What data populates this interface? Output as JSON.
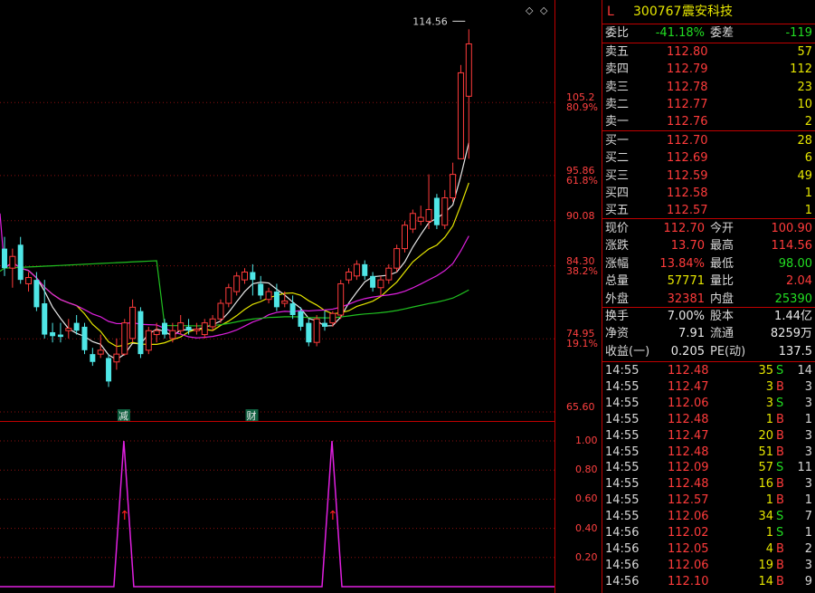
{
  "stock": {
    "flag": "L",
    "code": "300767",
    "name": "震安科技"
  },
  "orderbook": {
    "wb_label": "委比",
    "wb_value": "-41.18%",
    "wc_label": "委差",
    "wc_value": "-119",
    "asks": [
      {
        "label": "卖五",
        "price": "112.80",
        "vol": "57"
      },
      {
        "label": "卖四",
        "price": "112.79",
        "vol": "112"
      },
      {
        "label": "卖三",
        "price": "112.78",
        "vol": "23"
      },
      {
        "label": "卖二",
        "price": "112.77",
        "vol": "10"
      },
      {
        "label": "卖一",
        "price": "112.76",
        "vol": "2"
      }
    ],
    "bids": [
      {
        "label": "买一",
        "price": "112.70",
        "vol": "28"
      },
      {
        "label": "买二",
        "price": "112.69",
        "vol": "6"
      },
      {
        "label": "买三",
        "price": "112.59",
        "vol": "49"
      },
      {
        "label": "买四",
        "price": "112.58",
        "vol": "1"
      },
      {
        "label": "买五",
        "price": "112.57",
        "vol": "1"
      }
    ]
  },
  "stats": [
    {
      "l1": "现价",
      "v1": "112.70",
      "l2": "今开",
      "v2": "100.90",
      "c1": "red",
      "c2": "red"
    },
    {
      "l1": "涨跌",
      "v1": "13.70",
      "l2": "最高",
      "v2": "114.56",
      "c1": "red",
      "c2": "red"
    },
    {
      "l1": "涨幅",
      "v1": "13.84%",
      "l2": "最低",
      "v2": "98.00",
      "c1": "red",
      "c2": "green"
    },
    {
      "l1": "总量",
      "v1": "57771",
      "l2": "量比",
      "v2": "2.04",
      "c1": "yellow",
      "c2": "red"
    },
    {
      "l1": "外盘",
      "v1": "32381",
      "l2": "内盘",
      "v2": "25390",
      "c1": "red",
      "c2": "green"
    }
  ],
  "fundamentals": [
    {
      "l1": "换手",
      "v1": "7.00%",
      "l2": "股本",
      "v2": "1.44亿"
    },
    {
      "l1": "净资",
      "v1": "7.91",
      "l2": "流通",
      "v2": "8259万"
    },
    {
      "l1": "收益(一)",
      "v1": "0.205",
      "l2": "PE(动)",
      "v2": "137.5"
    }
  ],
  "ticks": [
    {
      "time": "14:55",
      "price": "112.48",
      "vol": "35",
      "side": "S",
      "n": "14"
    },
    {
      "time": "14:55",
      "price": "112.47",
      "vol": "3",
      "side": "B",
      "n": "3"
    },
    {
      "time": "14:55",
      "price": "112.06",
      "vol": "3",
      "side": "S",
      "n": "3"
    },
    {
      "time": "14:55",
      "price": "112.48",
      "vol": "1",
      "side": "B",
      "n": "1"
    },
    {
      "time": "14:55",
      "price": "112.47",
      "vol": "20",
      "side": "B",
      "n": "3"
    },
    {
      "time": "14:55",
      "price": "112.48",
      "vol": "51",
      "side": "B",
      "n": "3"
    },
    {
      "time": "14:55",
      "price": "112.09",
      "vol": "57",
      "side": "S",
      "n": "11"
    },
    {
      "time": "14:55",
      "price": "112.48",
      "vol": "16",
      "side": "B",
      "n": "3"
    },
    {
      "time": "14:55",
      "price": "112.57",
      "vol": "1",
      "side": "B",
      "n": "1"
    },
    {
      "time": "14:55",
      "price": "112.06",
      "vol": "34",
      "side": "S",
      "n": "7"
    },
    {
      "time": "14:56",
      "price": "112.02",
      "vol": "1",
      "side": "S",
      "n": "1"
    },
    {
      "time": "14:56",
      "price": "112.05",
      "vol": "4",
      "side": "B",
      "n": "2"
    },
    {
      "time": "14:56",
      "price": "112.06",
      "vol": "19",
      "side": "B",
      "n": "3"
    },
    {
      "time": "14:56",
      "price": "112.10",
      "vol": "14",
      "side": "B",
      "n": "9"
    }
  ],
  "chart_data": [
    {
      "type": "candlestick",
      "y_axis_labels": [
        {
          "price": "105.2",
          "pct": "80.9%"
        },
        {
          "price": "95.86",
          "pct": "61.8%"
        },
        {
          "price": "90.08",
          "pct": ""
        },
        {
          "price": "84.30",
          "pct": "38.2%"
        },
        {
          "price": "74.95",
          "pct": "19.1%"
        },
        {
          "price": "65.60",
          "pct": ""
        }
      ],
      "ylim": [
        65.6,
        116
      ],
      "high_marker": "114.56",
      "event_markers": [
        {
          "label": "减",
          "index": 14
        },
        {
          "label": "财",
          "index": 30
        }
      ],
      "candles": [
        {
          "o": 86.5,
          "h": 88.0,
          "c": 84.0,
          "l": 83.0
        },
        {
          "o": 84.0,
          "h": 86.5,
          "c": 85.5,
          "l": 81.5
        },
        {
          "o": 87.0,
          "h": 88.0,
          "c": 82.5,
          "l": 82.0
        },
        {
          "o": 82.0,
          "h": 83.5,
          "c": 82.8,
          "l": 81.0
        },
        {
          "o": 82.5,
          "h": 83.5,
          "c": 79.0,
          "l": 78.5
        },
        {
          "o": 79.5,
          "h": 82.5,
          "c": 75.5,
          "l": 75.0
        },
        {
          "o": 75.8,
          "h": 77.0,
          "c": 75.3,
          "l": 74.5
        },
        {
          "o": 75.5,
          "h": 77.0,
          "c": 75.2,
          "l": 74.5
        },
        {
          "o": 76.0,
          "h": 77.5,
          "c": 76.3,
          "l": 75.0
        },
        {
          "o": 77.0,
          "h": 78.0,
          "c": 76.0,
          "l": 75.5
        },
        {
          "o": 76.5,
          "h": 77.0,
          "c": 73.5,
          "l": 73.0
        },
        {
          "o": 73.0,
          "h": 73.8,
          "c": 72.0,
          "l": 71.5
        },
        {
          "o": 73.0,
          "h": 75.5,
          "c": 73.5,
          "l": 72.5
        },
        {
          "o": 72.5,
          "h": 73.0,
          "c": 69.5,
          "l": 68.8
        },
        {
          "o": 72.0,
          "h": 75.0,
          "c": 73.0,
          "l": 71.0
        },
        {
          "o": 73.0,
          "h": 77.5,
          "c": 77.0,
          "l": 72.8
        },
        {
          "o": 75.0,
          "h": 80.0,
          "c": 79.0,
          "l": 74.5
        },
        {
          "o": 78.5,
          "h": 79.0,
          "c": 73.0,
          "l": 72.5
        },
        {
          "o": 73.5,
          "h": 76.5,
          "c": 76.0,
          "l": 73.0
        },
        {
          "o": 75.5,
          "h": 77.0,
          "c": 76.0,
          "l": 74.5
        },
        {
          "o": 77.0,
          "h": 77.5,
          "c": 75.5,
          "l": 75.0
        },
        {
          "o": 75.0,
          "h": 77.0,
          "c": 76.0,
          "l": 74.5
        },
        {
          "o": 76.0,
          "h": 78.0,
          "c": 77.0,
          "l": 75.5
        },
        {
          "o": 76.5,
          "h": 77.5,
          "c": 76.0,
          "l": 75.5
        },
        {
          "o": 76.0,
          "h": 77.0,
          "c": 76.2,
          "l": 75.5
        },
        {
          "o": 75.5,
          "h": 77.5,
          "c": 77.0,
          "l": 75.0
        },
        {
          "o": 76.5,
          "h": 78.0,
          "c": 77.5,
          "l": 76.0
        },
        {
          "o": 77.5,
          "h": 80.0,
          "c": 79.5,
          "l": 77.0
        },
        {
          "o": 79.5,
          "h": 82.0,
          "c": 81.5,
          "l": 79.0
        },
        {
          "o": 81.0,
          "h": 83.5,
          "c": 83.0,
          "l": 80.5
        },
        {
          "o": 82.5,
          "h": 84.0,
          "c": 83.5,
          "l": 82.0
        },
        {
          "o": 83.5,
          "h": 84.5,
          "c": 82.5,
          "l": 80.5
        },
        {
          "o": 82.0,
          "h": 83.0,
          "c": 80.5,
          "l": 80.0
        },
        {
          "o": 80.0,
          "h": 81.5,
          "c": 81.0,
          "l": 79.5
        },
        {
          "o": 81.0,
          "h": 82.0,
          "c": 79.0,
          "l": 78.5
        },
        {
          "o": 79.5,
          "h": 81.0,
          "c": 79.8,
          "l": 79.0
        },
        {
          "o": 79.5,
          "h": 80.5,
          "c": 78.0,
          "l": 77.5
        },
        {
          "o": 78.5,
          "h": 79.0,
          "c": 76.5,
          "l": 76.0
        },
        {
          "o": 77.0,
          "h": 77.5,
          "c": 74.5,
          "l": 74.0
        },
        {
          "o": 74.5,
          "h": 78.0,
          "c": 77.5,
          "l": 74.0
        },
        {
          "o": 77.0,
          "h": 78.5,
          "c": 76.5,
          "l": 76.0
        },
        {
          "o": 77.0,
          "h": 78.5,
          "c": 78.2,
          "l": 76.5
        },
        {
          "o": 78.0,
          "h": 82.5,
          "c": 82.0,
          "l": 77.5
        },
        {
          "o": 82.5,
          "h": 84.0,
          "c": 83.5,
          "l": 82.0
        },
        {
          "o": 83.0,
          "h": 85.0,
          "c": 84.5,
          "l": 82.5
        },
        {
          "o": 84.5,
          "h": 85.0,
          "c": 83.0,
          "l": 82.5
        },
        {
          "o": 83.0,
          "h": 83.5,
          "c": 81.5,
          "l": 81.0
        },
        {
          "o": 81.5,
          "h": 83.0,
          "c": 82.5,
          "l": 80.5
        },
        {
          "o": 82.5,
          "h": 84.5,
          "c": 84.0,
          "l": 82.0
        },
        {
          "o": 84.0,
          "h": 87.0,
          "c": 86.5,
          "l": 83.5
        },
        {
          "o": 86.5,
          "h": 90.0,
          "c": 89.5,
          "l": 86.0
        },
        {
          "o": 89.0,
          "h": 91.5,
          "c": 91.0,
          "l": 88.5
        },
        {
          "o": 90.0,
          "h": 92.0,
          "c": 90.5,
          "l": 89.5
        },
        {
          "o": 90.0,
          "h": 96.0,
          "c": 91.5,
          "l": 89.0
        },
        {
          "o": 93.0,
          "h": 93.5,
          "c": 89.5,
          "l": 89.0
        },
        {
          "o": 89.5,
          "h": 94.0,
          "c": 93.0,
          "l": 89.0
        },
        {
          "o": 93.0,
          "h": 97.5,
          "c": 96.0,
          "l": 92.5
        },
        {
          "o": 98.0,
          "h": 110.0,
          "c": 109.0,
          "l": 98.0
        },
        {
          "o": 106.0,
          "h": 114.56,
          "c": 112.7,
          "l": 98.0
        }
      ]
    },
    {
      "type": "line",
      "y_axis_labels": [
        "1.00",
        "0.80",
        "0.60",
        "0.40",
        "0.20"
      ],
      "ylim": [
        0,
        1.1
      ],
      "values": [
        0,
        0,
        0,
        0,
        0,
        0,
        0,
        0,
        0,
        0,
        0,
        0,
        0,
        0,
        1,
        0,
        0,
        0,
        0,
        0,
        0,
        0,
        0,
        0,
        0,
        0,
        0,
        0,
        0,
        0,
        0,
        0,
        0,
        0,
        0,
        0,
        0,
        0,
        0,
        0,
        1,
        0,
        0,
        0,
        0,
        0,
        0,
        0,
        0,
        0,
        0,
        0,
        0,
        0,
        0,
        0,
        0,
        0,
        0
      ],
      "signal_indices": [
        14,
        40
      ]
    }
  ]
}
